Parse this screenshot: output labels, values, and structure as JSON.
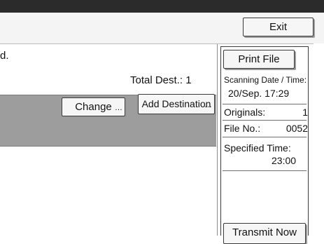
{
  "header": {
    "exit_label": "Exit"
  },
  "main": {
    "message_tail": "d.",
    "total_dest_label": "Total Dest.: 1",
    "change_label": "Change",
    "add_destination_label": "Add Destination"
  },
  "side": {
    "print_file_label": "Print File",
    "scanning_date_label": "Scanning Date / Time:",
    "scanning_date_value": "20/Sep.  17:29",
    "originals_label": "Originals:",
    "originals_value": "1",
    "file_no_label": "File No.:",
    "file_no_value": "0052",
    "specified_time_label": "Specified Time:",
    "specified_time_value": "23:00",
    "transmit_now_label": "Transmit Now"
  }
}
